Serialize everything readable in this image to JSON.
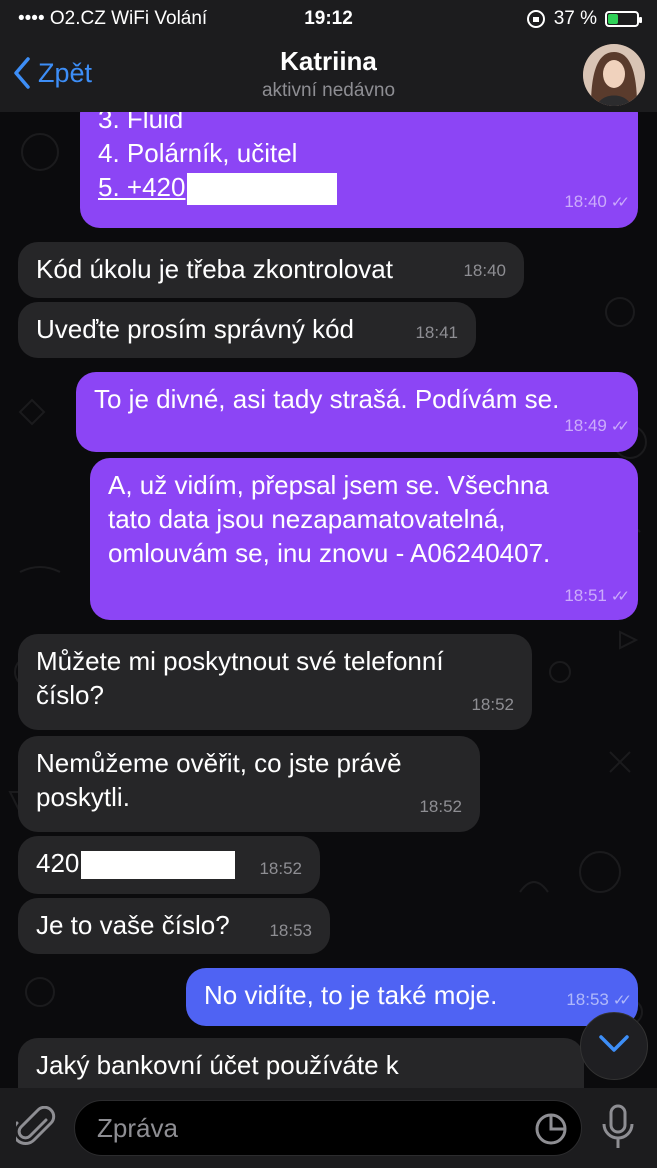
{
  "status_bar": {
    "carrier": "•••• O2.CZ WiFi Volání",
    "time": "19:12",
    "battery": "37 %",
    "battery_level": 0.37
  },
  "header": {
    "back_label": "Zpět",
    "contact_name": "Katriina",
    "contact_status": "aktivní nedávno"
  },
  "messages": {
    "m1": {
      "line1": "3. Fluid",
      "line2": "4. Polárník, učitel",
      "line3_prefix": "5. +420",
      "time": "18:40"
    },
    "m2": {
      "text": "Kód úkolu je třeba zkontrolovat",
      "time": "18:40"
    },
    "m3": {
      "text": "Uveďte prosím správný kód",
      "time": "18:41"
    },
    "m4": {
      "text": "To je divné, asi tady strašá. Podívám se.",
      "time": "18:49"
    },
    "m5": {
      "line1": "A, už vidím, přepsal jsem se. Všechna",
      "line2": "tato data jsou nezapamatovatelná,",
      "line3": "omlouvám se, inu znovu - A06240407.",
      "time": "18:51"
    },
    "m6": {
      "line1": "Můžete mi poskytnout své telefonní",
      "line2": "číslo?",
      "time": "18:52"
    },
    "m7": {
      "line1": "Nemůžeme ověřit, co jste právě",
      "line2": "poskytli.",
      "time": "18:52"
    },
    "m8": {
      "prefix": "420",
      "time": "18:52"
    },
    "m9": {
      "text": "Je to vaše číslo?",
      "time": "18:53"
    },
    "m10": {
      "text": "No vidíte, to je také moje.",
      "time": "18:53"
    },
    "m11": {
      "text": "Jaký bankovní účet používáte k"
    }
  },
  "composer": {
    "placeholder": "Zpráva"
  },
  "icons": {
    "back": "chevron-left-icon",
    "attach": "paperclip-icon",
    "sticker": "sticker-icon",
    "mic": "microphone-icon",
    "scroll": "chevron-down-icon"
  },
  "colors": {
    "outgoing_purple": "#8c45f5",
    "outgoing_blue": "#4f63f3",
    "incoming": "#262628",
    "accent": "#3d8ef7"
  }
}
